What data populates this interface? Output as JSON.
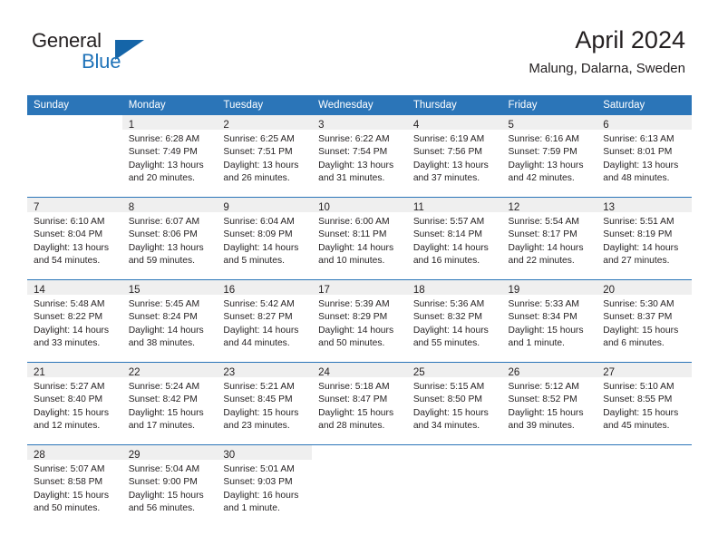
{
  "logo": {
    "word_one": "General",
    "word_two": "Blue",
    "icon": "triangle-logo-icon"
  },
  "header": {
    "title": "April 2024",
    "subtitle": "Malung, Dalarna, Sweden"
  },
  "colors": {
    "header_blue": "#2b75b8",
    "daynum_gray": "#efefef",
    "logo_blue": "#1e72b8",
    "text": "#231f20"
  },
  "weekday_headers": [
    "Sunday",
    "Monday",
    "Tuesday",
    "Wednesday",
    "Thursday",
    "Friday",
    "Saturday"
  ],
  "weeks": [
    [
      {
        "day": "",
        "lines": []
      },
      {
        "day": "1",
        "lines": [
          "Sunrise: 6:28 AM",
          "Sunset: 7:49 PM",
          "Daylight: 13 hours",
          "and 20 minutes."
        ]
      },
      {
        "day": "2",
        "lines": [
          "Sunrise: 6:25 AM",
          "Sunset: 7:51 PM",
          "Daylight: 13 hours",
          "and 26 minutes."
        ]
      },
      {
        "day": "3",
        "lines": [
          "Sunrise: 6:22 AM",
          "Sunset: 7:54 PM",
          "Daylight: 13 hours",
          "and 31 minutes."
        ]
      },
      {
        "day": "4",
        "lines": [
          "Sunrise: 6:19 AM",
          "Sunset: 7:56 PM",
          "Daylight: 13 hours",
          "and 37 minutes."
        ]
      },
      {
        "day": "5",
        "lines": [
          "Sunrise: 6:16 AM",
          "Sunset: 7:59 PM",
          "Daylight: 13 hours",
          "and 42 minutes."
        ]
      },
      {
        "day": "6",
        "lines": [
          "Sunrise: 6:13 AM",
          "Sunset: 8:01 PM",
          "Daylight: 13 hours",
          "and 48 minutes."
        ]
      }
    ],
    [
      {
        "day": "7",
        "lines": [
          "Sunrise: 6:10 AM",
          "Sunset: 8:04 PM",
          "Daylight: 13 hours",
          "and 54 minutes."
        ]
      },
      {
        "day": "8",
        "lines": [
          "Sunrise: 6:07 AM",
          "Sunset: 8:06 PM",
          "Daylight: 13 hours",
          "and 59 minutes."
        ]
      },
      {
        "day": "9",
        "lines": [
          "Sunrise: 6:04 AM",
          "Sunset: 8:09 PM",
          "Daylight: 14 hours",
          "and 5 minutes."
        ]
      },
      {
        "day": "10",
        "lines": [
          "Sunrise: 6:00 AM",
          "Sunset: 8:11 PM",
          "Daylight: 14 hours",
          "and 10 minutes."
        ]
      },
      {
        "day": "11",
        "lines": [
          "Sunrise: 5:57 AM",
          "Sunset: 8:14 PM",
          "Daylight: 14 hours",
          "and 16 minutes."
        ]
      },
      {
        "day": "12",
        "lines": [
          "Sunrise: 5:54 AM",
          "Sunset: 8:17 PM",
          "Daylight: 14 hours",
          "and 22 minutes."
        ]
      },
      {
        "day": "13",
        "lines": [
          "Sunrise: 5:51 AM",
          "Sunset: 8:19 PM",
          "Daylight: 14 hours",
          "and 27 minutes."
        ]
      }
    ],
    [
      {
        "day": "14",
        "lines": [
          "Sunrise: 5:48 AM",
          "Sunset: 8:22 PM",
          "Daylight: 14 hours",
          "and 33 minutes."
        ]
      },
      {
        "day": "15",
        "lines": [
          "Sunrise: 5:45 AM",
          "Sunset: 8:24 PM",
          "Daylight: 14 hours",
          "and 38 minutes."
        ]
      },
      {
        "day": "16",
        "lines": [
          "Sunrise: 5:42 AM",
          "Sunset: 8:27 PM",
          "Daylight: 14 hours",
          "and 44 minutes."
        ]
      },
      {
        "day": "17",
        "lines": [
          "Sunrise: 5:39 AM",
          "Sunset: 8:29 PM",
          "Daylight: 14 hours",
          "and 50 minutes."
        ]
      },
      {
        "day": "18",
        "lines": [
          "Sunrise: 5:36 AM",
          "Sunset: 8:32 PM",
          "Daylight: 14 hours",
          "and 55 minutes."
        ]
      },
      {
        "day": "19",
        "lines": [
          "Sunrise: 5:33 AM",
          "Sunset: 8:34 PM",
          "Daylight: 15 hours",
          "and 1 minute."
        ]
      },
      {
        "day": "20",
        "lines": [
          "Sunrise: 5:30 AM",
          "Sunset: 8:37 PM",
          "Daylight: 15 hours",
          "and 6 minutes."
        ]
      }
    ],
    [
      {
        "day": "21",
        "lines": [
          "Sunrise: 5:27 AM",
          "Sunset: 8:40 PM",
          "Daylight: 15 hours",
          "and 12 minutes."
        ]
      },
      {
        "day": "22",
        "lines": [
          "Sunrise: 5:24 AM",
          "Sunset: 8:42 PM",
          "Daylight: 15 hours",
          "and 17 minutes."
        ]
      },
      {
        "day": "23",
        "lines": [
          "Sunrise: 5:21 AM",
          "Sunset: 8:45 PM",
          "Daylight: 15 hours",
          "and 23 minutes."
        ]
      },
      {
        "day": "24",
        "lines": [
          "Sunrise: 5:18 AM",
          "Sunset: 8:47 PM",
          "Daylight: 15 hours",
          "and 28 minutes."
        ]
      },
      {
        "day": "25",
        "lines": [
          "Sunrise: 5:15 AM",
          "Sunset: 8:50 PM",
          "Daylight: 15 hours",
          "and 34 minutes."
        ]
      },
      {
        "day": "26",
        "lines": [
          "Sunrise: 5:12 AM",
          "Sunset: 8:52 PM",
          "Daylight: 15 hours",
          "and 39 minutes."
        ]
      },
      {
        "day": "27",
        "lines": [
          "Sunrise: 5:10 AM",
          "Sunset: 8:55 PM",
          "Daylight: 15 hours",
          "and 45 minutes."
        ]
      }
    ],
    [
      {
        "day": "28",
        "lines": [
          "Sunrise: 5:07 AM",
          "Sunset: 8:58 PM",
          "Daylight: 15 hours",
          "and 50 minutes."
        ]
      },
      {
        "day": "29",
        "lines": [
          "Sunrise: 5:04 AM",
          "Sunset: 9:00 PM",
          "Daylight: 15 hours",
          "and 56 minutes."
        ]
      },
      {
        "day": "30",
        "lines": [
          "Sunrise: 5:01 AM",
          "Sunset: 9:03 PM",
          "Daylight: 16 hours",
          "and 1 minute."
        ]
      },
      {
        "day": "",
        "lines": []
      },
      {
        "day": "",
        "lines": []
      },
      {
        "day": "",
        "lines": []
      },
      {
        "day": "",
        "lines": []
      }
    ]
  ]
}
